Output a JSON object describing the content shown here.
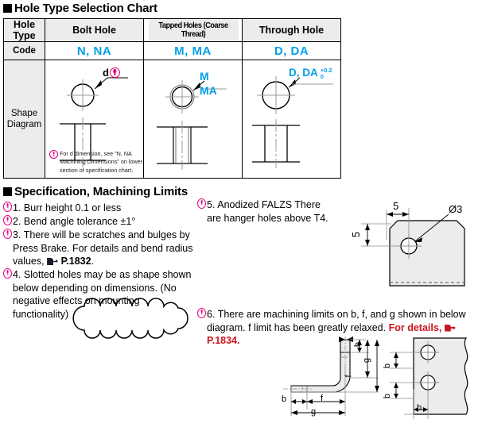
{
  "sections": {
    "chart_title": "Hole Type Selection Chart",
    "spec_title": "Specification, Machining Limits"
  },
  "hole_chart": {
    "row_labels": {
      "hole_type": "Hole Type",
      "code": "Code",
      "shape_diagram": "Shape\nDiagram"
    },
    "columns": [
      {
        "header": "Bolt Hole",
        "code": "N, NA",
        "diagram_label": "d"
      },
      {
        "header": "Tapped Holes (Coarse Thread)",
        "code": "M, MA",
        "diagram_label": "M",
        "diagram_label2": "MA"
      },
      {
        "header": "Through Hole",
        "code": "D, DA",
        "diagram_label": "D, DA",
        "tol_upper": "+0.2",
        "tol_lower": "0"
      }
    ],
    "footnote": "For d dimension, see \"N, NA Machining Dimensions\" on lower section of specification chart."
  },
  "spec_items_left": [
    {
      "num": "1.",
      "text": "Burr height 0.1 or less"
    },
    {
      "num": "2.",
      "text": "Bend angle tolerance ±1°"
    },
    {
      "num": "3.",
      "text": "There will be scratches and bulges by Press Brake. For details and bend radius values,",
      "link": "P.1832",
      "link_suffix": "."
    },
    {
      "num": "4.",
      "text": "Slotted holes may be as shape shown below depending on dimensions. (No negative effects on mounting functionality)"
    }
  ],
  "spec_items_right": [
    {
      "num": "5.",
      "text": "Anodized FALZS There are hanger holes above T4."
    },
    {
      "num": "6.",
      "text": "There are machining limits on b, f, and g shown in below diagram. f limit has been greatly relaxed.",
      "red_text": "For details,",
      "link": "P.1834",
      "link_suffix": "."
    }
  ],
  "hanger_diagram": {
    "dim_horizontal": "5",
    "dim_vertical": "5",
    "hole_label": "Ø3"
  },
  "limits_diagram": {
    "bend_dims": [
      "b",
      "g",
      "f",
      "b",
      "f",
      "g"
    ],
    "plate_dims": [
      "b",
      "b",
      "b"
    ]
  },
  "colors": {
    "code_cyan": "#00a0e9",
    "note_magenta": "#e4007f",
    "link_red": "#c8161d",
    "header_gray": "#ececec",
    "part_fill": "#ececec"
  }
}
